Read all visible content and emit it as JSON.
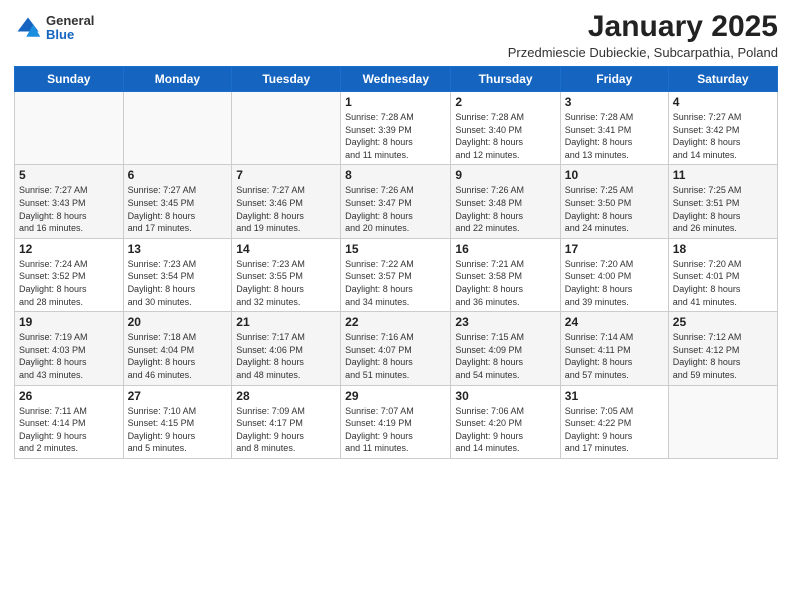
{
  "header": {
    "logo_general": "General",
    "logo_blue": "Blue",
    "month_title": "January 2025",
    "location": "Przedmiescie Dubieckie, Subcarpathia, Poland"
  },
  "days_of_week": [
    "Sunday",
    "Monday",
    "Tuesday",
    "Wednesday",
    "Thursday",
    "Friday",
    "Saturday"
  ],
  "weeks": [
    [
      {
        "day": "",
        "info": ""
      },
      {
        "day": "",
        "info": ""
      },
      {
        "day": "",
        "info": ""
      },
      {
        "day": "1",
        "info": "Sunrise: 7:28 AM\nSunset: 3:39 PM\nDaylight: 8 hours\nand 11 minutes."
      },
      {
        "day": "2",
        "info": "Sunrise: 7:28 AM\nSunset: 3:40 PM\nDaylight: 8 hours\nand 12 minutes."
      },
      {
        "day": "3",
        "info": "Sunrise: 7:28 AM\nSunset: 3:41 PM\nDaylight: 8 hours\nand 13 minutes."
      },
      {
        "day": "4",
        "info": "Sunrise: 7:27 AM\nSunset: 3:42 PM\nDaylight: 8 hours\nand 14 minutes."
      }
    ],
    [
      {
        "day": "5",
        "info": "Sunrise: 7:27 AM\nSunset: 3:43 PM\nDaylight: 8 hours\nand 16 minutes."
      },
      {
        "day": "6",
        "info": "Sunrise: 7:27 AM\nSunset: 3:45 PM\nDaylight: 8 hours\nand 17 minutes."
      },
      {
        "day": "7",
        "info": "Sunrise: 7:27 AM\nSunset: 3:46 PM\nDaylight: 8 hours\nand 19 minutes."
      },
      {
        "day": "8",
        "info": "Sunrise: 7:26 AM\nSunset: 3:47 PM\nDaylight: 8 hours\nand 20 minutes."
      },
      {
        "day": "9",
        "info": "Sunrise: 7:26 AM\nSunset: 3:48 PM\nDaylight: 8 hours\nand 22 minutes."
      },
      {
        "day": "10",
        "info": "Sunrise: 7:25 AM\nSunset: 3:50 PM\nDaylight: 8 hours\nand 24 minutes."
      },
      {
        "day": "11",
        "info": "Sunrise: 7:25 AM\nSunset: 3:51 PM\nDaylight: 8 hours\nand 26 minutes."
      }
    ],
    [
      {
        "day": "12",
        "info": "Sunrise: 7:24 AM\nSunset: 3:52 PM\nDaylight: 8 hours\nand 28 minutes."
      },
      {
        "day": "13",
        "info": "Sunrise: 7:23 AM\nSunset: 3:54 PM\nDaylight: 8 hours\nand 30 minutes."
      },
      {
        "day": "14",
        "info": "Sunrise: 7:23 AM\nSunset: 3:55 PM\nDaylight: 8 hours\nand 32 minutes."
      },
      {
        "day": "15",
        "info": "Sunrise: 7:22 AM\nSunset: 3:57 PM\nDaylight: 8 hours\nand 34 minutes."
      },
      {
        "day": "16",
        "info": "Sunrise: 7:21 AM\nSunset: 3:58 PM\nDaylight: 8 hours\nand 36 minutes."
      },
      {
        "day": "17",
        "info": "Sunrise: 7:20 AM\nSunset: 4:00 PM\nDaylight: 8 hours\nand 39 minutes."
      },
      {
        "day": "18",
        "info": "Sunrise: 7:20 AM\nSunset: 4:01 PM\nDaylight: 8 hours\nand 41 minutes."
      }
    ],
    [
      {
        "day": "19",
        "info": "Sunrise: 7:19 AM\nSunset: 4:03 PM\nDaylight: 8 hours\nand 43 minutes."
      },
      {
        "day": "20",
        "info": "Sunrise: 7:18 AM\nSunset: 4:04 PM\nDaylight: 8 hours\nand 46 minutes."
      },
      {
        "day": "21",
        "info": "Sunrise: 7:17 AM\nSunset: 4:06 PM\nDaylight: 8 hours\nand 48 minutes."
      },
      {
        "day": "22",
        "info": "Sunrise: 7:16 AM\nSunset: 4:07 PM\nDaylight: 8 hours\nand 51 minutes."
      },
      {
        "day": "23",
        "info": "Sunrise: 7:15 AM\nSunset: 4:09 PM\nDaylight: 8 hours\nand 54 minutes."
      },
      {
        "day": "24",
        "info": "Sunrise: 7:14 AM\nSunset: 4:11 PM\nDaylight: 8 hours\nand 57 minutes."
      },
      {
        "day": "25",
        "info": "Sunrise: 7:12 AM\nSunset: 4:12 PM\nDaylight: 8 hours\nand 59 minutes."
      }
    ],
    [
      {
        "day": "26",
        "info": "Sunrise: 7:11 AM\nSunset: 4:14 PM\nDaylight: 9 hours\nand 2 minutes."
      },
      {
        "day": "27",
        "info": "Sunrise: 7:10 AM\nSunset: 4:15 PM\nDaylight: 9 hours\nand 5 minutes."
      },
      {
        "day": "28",
        "info": "Sunrise: 7:09 AM\nSunset: 4:17 PM\nDaylight: 9 hours\nand 8 minutes."
      },
      {
        "day": "29",
        "info": "Sunrise: 7:07 AM\nSunset: 4:19 PM\nDaylight: 9 hours\nand 11 minutes."
      },
      {
        "day": "30",
        "info": "Sunrise: 7:06 AM\nSunset: 4:20 PM\nDaylight: 9 hours\nand 14 minutes."
      },
      {
        "day": "31",
        "info": "Sunrise: 7:05 AM\nSunset: 4:22 PM\nDaylight: 9 hours\nand 17 minutes."
      },
      {
        "day": "",
        "info": ""
      }
    ]
  ]
}
